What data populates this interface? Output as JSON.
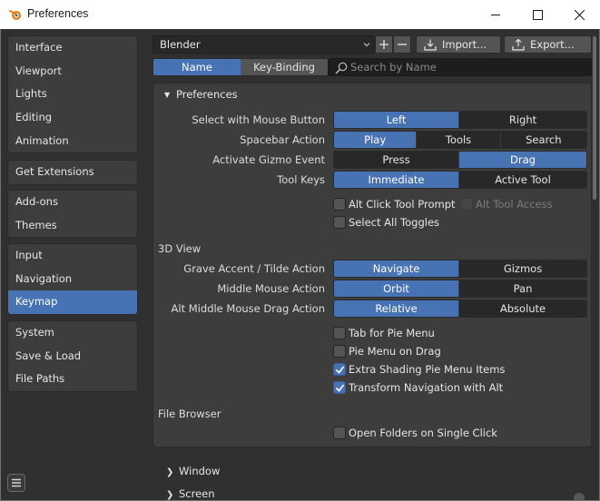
{
  "window": {
    "title": "Preferences",
    "icon": "blender-logo-icon"
  },
  "sidebar": {
    "groups": [
      {
        "items": [
          {
            "label": "Interface"
          },
          {
            "label": "Viewport"
          },
          {
            "label": "Lights"
          },
          {
            "label": "Editing"
          },
          {
            "label": "Animation"
          }
        ]
      },
      {
        "items": [
          {
            "label": "Get Extensions"
          }
        ]
      },
      {
        "items": [
          {
            "label": "Add-ons"
          },
          {
            "label": "Themes"
          }
        ]
      },
      {
        "items": [
          {
            "label": "Input"
          },
          {
            "label": "Navigation"
          },
          {
            "label": "Keymap",
            "active": true
          }
        ]
      },
      {
        "items": [
          {
            "label": "System"
          },
          {
            "label": "Save & Load"
          },
          {
            "label": "File Paths"
          }
        ]
      }
    ]
  },
  "toolbar": {
    "preset_value": "Blender",
    "add_icon": "plus-icon",
    "remove_icon": "minus-icon",
    "import_label": "Import...",
    "export_label": "Export..."
  },
  "tabs": [
    {
      "label": "Name",
      "active": true
    },
    {
      "label": "Key-Binding",
      "active": false
    }
  ],
  "search": {
    "placeholder": "Search by Name"
  },
  "panel": {
    "header": "Preferences",
    "rows": [
      {
        "label": "Select with Mouse Button",
        "options": [
          "Left",
          "Right"
        ],
        "selected": 0
      },
      {
        "label": "Spacebar Action",
        "options": [
          "Play",
          "Tools",
          "Search"
        ],
        "selected": 0
      },
      {
        "label": "Activate Gizmo Event",
        "options": [
          "Press",
          "Drag"
        ],
        "selected": 1
      },
      {
        "label": "Tool Keys",
        "options": [
          "Immediate",
          "Active Tool"
        ],
        "selected": 0
      }
    ],
    "checks1": [
      {
        "label": "Alt Click Tool Prompt",
        "checked": false
      },
      {
        "label": "Alt Tool Access",
        "checked": false,
        "disabled": true
      },
      {
        "label": "Select All Toggles",
        "checked": false
      }
    ],
    "view3d": {
      "title": "3D View",
      "rows": [
        {
          "label": "Grave Accent / Tilde Action",
          "options": [
            "Navigate",
            "Gizmos"
          ],
          "selected": 0
        },
        {
          "label": "Middle Mouse Action",
          "options": [
            "Orbit",
            "Pan"
          ],
          "selected": 0
        },
        {
          "label": "Alt Middle Mouse Drag Action",
          "options": [
            "Relative",
            "Absolute"
          ],
          "selected": 0
        }
      ],
      "checks": [
        {
          "label": "Tab for Pie Menu",
          "checked": false
        },
        {
          "label": "Pie Menu on Drag",
          "checked": false
        },
        {
          "label": "Extra Shading Pie Menu Items",
          "checked": true
        },
        {
          "label": "Transform Navigation with Alt",
          "checked": true
        }
      ]
    },
    "file_browser": {
      "title": "File Browser",
      "checks": [
        {
          "label": "Open Folders on Single Click",
          "checked": false
        }
      ]
    }
  },
  "collapsed_sections": [
    {
      "label": "Window"
    },
    {
      "label": "Screen"
    }
  ],
  "colors": {
    "accent": "#4772b3",
    "panel": "#3d3d3d",
    "background": "#303030"
  }
}
